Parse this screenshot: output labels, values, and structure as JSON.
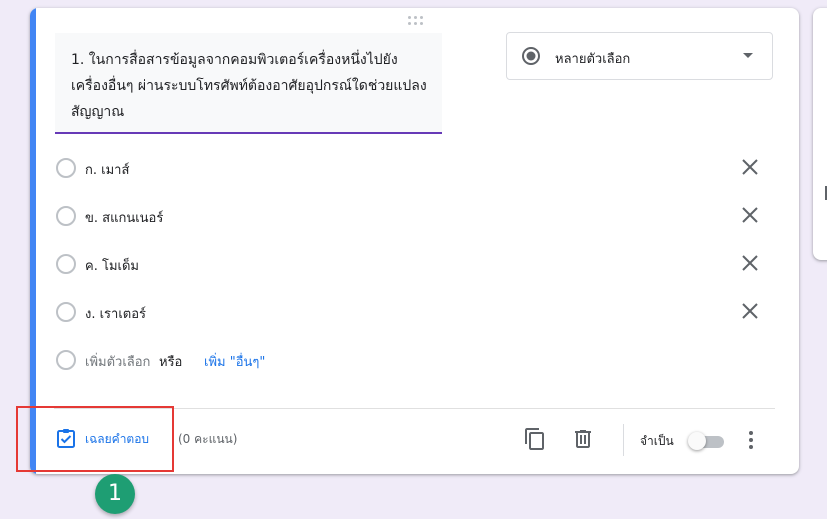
{
  "question": {
    "text": "1. ในการสื่อสารข้อมูลจากคอมพิวเตอร์เครื่องหนึ่งไปยังเครื่องอื่นๆ ผ่านระบบโทรศัพท์ต้องอาศัยอุปกรณ์ใดช่วยแปลงสัญญาณ"
  },
  "question_type": {
    "selected": "หลายตัวเลือก",
    "icon": "radio-button-checked-icon"
  },
  "options": [
    {
      "label": "ก. เมาส์"
    },
    {
      "label": "ข. สแกนเนอร์"
    },
    {
      "label": "ค. โมเด็ม"
    },
    {
      "label": "ง. เราเตอร์"
    }
  ],
  "add_option": {
    "label": "เพิ่มตัวเลือก",
    "or": "หรือ",
    "add_other": "เพิ่ม \"อื่นๆ\""
  },
  "footer": {
    "answer_key_label": "เฉลยคำตอบ",
    "points": "(0 คะแนน)",
    "required_label": "จำเป็น",
    "required_on": false
  },
  "annotation": {
    "step_number": "1",
    "highlight_color": "#e53935",
    "badge_color": "#1e9e73"
  },
  "colors": {
    "accent": "#4285f4",
    "link": "#1a73e8",
    "underline": "#673ab7",
    "background": "#f0ebf8"
  }
}
